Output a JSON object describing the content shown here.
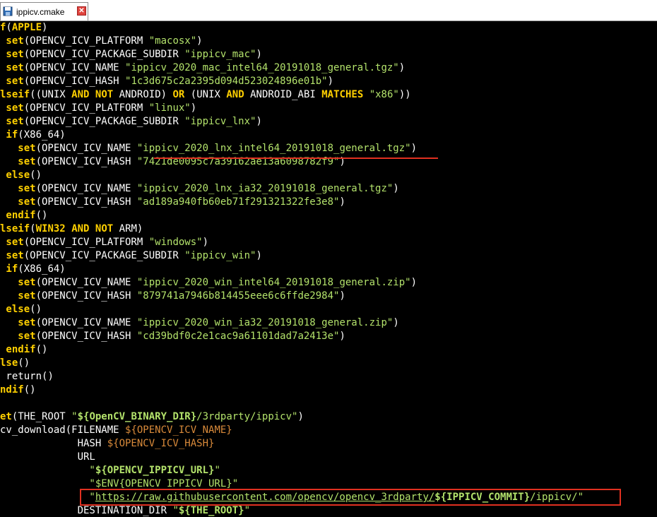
{
  "tab": {
    "label": "ippicv.cmake",
    "close": "✕"
  },
  "code": {
    "l01": {
      "a": "f",
      "b": "(",
      "c": "APPLE",
      "d": ")"
    },
    "l02": {
      "a": " set",
      "b": "(OPENCV_ICV_PLATFORM ",
      "c": "\"macosx\"",
      "d": ")"
    },
    "l03": {
      "a": " set",
      "b": "(OPENCV_ICV_PACKAGE_SUBDIR ",
      "c": "\"ippicv_mac\"",
      "d": ")"
    },
    "l04": {
      "a": " set",
      "b": "(OPENCV_ICV_NAME ",
      "c": "\"ippicv_2020_mac_intel64_20191018_general.tgz\"",
      "d": ")"
    },
    "l05": {
      "a": " set",
      "b": "(OPENCV_ICV_HASH ",
      "c": "\"1c3d675c2a2395d094d523024896e01b\"",
      "d": ")"
    },
    "l06": {
      "a": "lseif",
      "b": "((UNIX ",
      "c": "AND",
      "d": " ",
      "e": "NOT",
      "f": " ANDROID) ",
      "g": "OR",
      "h": " (UNIX ",
      "i": "AND",
      "j": " ANDROID_ABI ",
      "k": "MATCHES",
      "l": " ",
      "m": "\"x86\"",
      "n": "))"
    },
    "l07": {
      "a": " set",
      "b": "(OPENCV_ICV_PLATFORM ",
      "c": "\"linux\"",
      "d": ")"
    },
    "l08": {
      "a": " set",
      "b": "(OPENCV_ICV_PACKAGE_SUBDIR ",
      "c": "\"ippicv_lnx\"",
      "d": ")"
    },
    "l09": {
      "a": " if",
      "b": "(X86_64)"
    },
    "l10": {
      "a": "   set",
      "b": "(OPENCV_ICV_NAME ",
      "c": "\"ippicv_2020_lnx_intel64_20191018_general.tgz\"",
      "d": ")"
    },
    "l11": {
      "a": "   set",
      "b": "(OPENCV_ICV_HASH ",
      "c": "\"7421de0095c7a39162ae13a6098782f9\"",
      "d": ")"
    },
    "l12": {
      "a": " else",
      "b": "()"
    },
    "l13": {
      "a": "   set",
      "b": "(OPENCV_ICV_NAME ",
      "c": "\"ippicv_2020_lnx_ia32_20191018_general.tgz\"",
      "d": ")"
    },
    "l14": {
      "a": "   set",
      "b": "(OPENCV_ICV_HASH ",
      "c": "\"ad189a940fb60eb71f291321322fe3e8\"",
      "d": ")"
    },
    "l15": {
      "a": " endif",
      "b": "()"
    },
    "l16": {
      "a": "lseif",
      "b": "(",
      "c": "WIN32",
      "d": " ",
      "e": "AND",
      "f": " ",
      "g": "NOT",
      "h": " ARM)"
    },
    "l17": {
      "a": " set",
      "b": "(OPENCV_ICV_PLATFORM ",
      "c": "\"windows\"",
      "d": ")"
    },
    "l18": {
      "a": " set",
      "b": "(OPENCV_ICV_PACKAGE_SUBDIR ",
      "c": "\"ippicv_win\"",
      "d": ")"
    },
    "l19": {
      "a": " if",
      "b": "(X86_64)"
    },
    "l20": {
      "a": "   set",
      "b": "(OPENCV_ICV_NAME ",
      "c": "\"ippicv_2020_win_intel64_20191018_general.zip\"",
      "d": ")"
    },
    "l21": {
      "a": "   set",
      "b": "(OPENCV_ICV_HASH ",
      "c": "\"879741a7946b814455eee6c6ffde2984\"",
      "d": ")"
    },
    "l22": {
      "a": " else",
      "b": "()"
    },
    "l23": {
      "a": "   set",
      "b": "(OPENCV_ICV_NAME ",
      "c": "\"ippicv_2020_win_ia32_20191018_general.zip\"",
      "d": ")"
    },
    "l24": {
      "a": "   set",
      "b": "(OPENCV_ICV_HASH ",
      "c": "\"cd39bdf0c2e1cac9a61101dad7a2413e\"",
      "d": ")"
    },
    "l25": {
      "a": " endif",
      "b": "()"
    },
    "l26": {
      "a": "lse",
      "b": "()"
    },
    "l27": {
      "a": " return",
      "b": "()"
    },
    "l28": {
      "a": "ndif",
      "b": "()"
    },
    "l29": {
      "a": "et",
      "b": "(THE_ROOT ",
      "c": "\"",
      "d": "${OpenCV_BINARY_DIR}",
      "e": "/3rdparty/ippicv\"",
      "f": ")"
    },
    "l30": {
      "a": "cv_download(FILENAME ",
      "b": "${OPENCV_ICV_NAME}"
    },
    "l31": {
      "a": "             HASH ",
      "b": "${OPENCV_ICV_HASH}"
    },
    "l32": {
      "a": "             URL"
    },
    "l33": {
      "a": "               \"",
      "b": "${OPENCV_IPPICV_URL}",
      "c": "\""
    },
    "l34": {
      "a": "               \"$ENV{OPENCV_IPPICV_URL}\""
    },
    "l35": {
      "a": "               \"",
      "b": "https://raw.githubusercontent.com/opencv/opencv_3rdparty/",
      "c": "${IPPICV_COMMIT}",
      "d": "/ippicv/",
      "e": "\""
    },
    "l36": {
      "a": "             DESTINATION_DIR ",
      "b": "\"",
      "c": "${THE_ROOT}",
      "d": "\""
    }
  }
}
